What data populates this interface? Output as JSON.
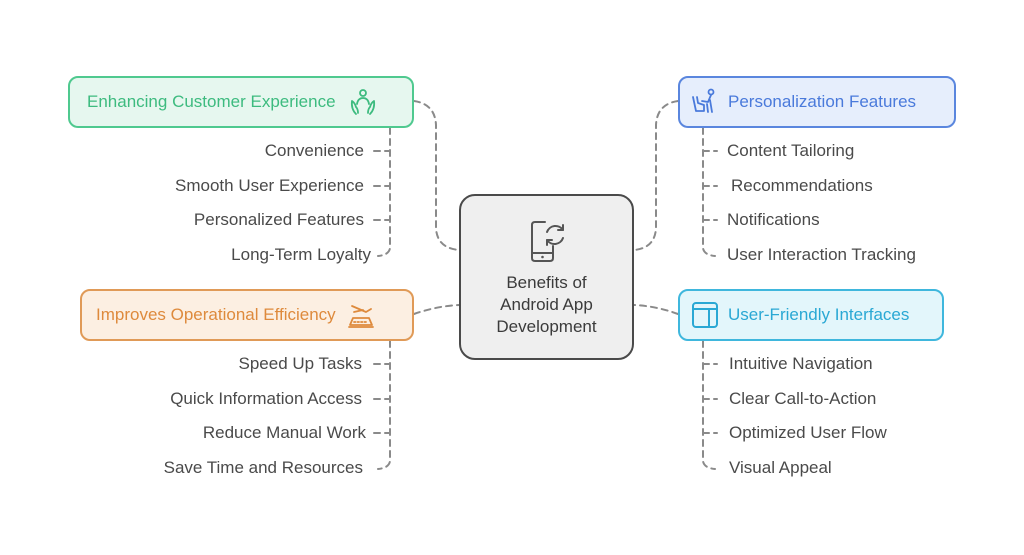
{
  "diagram": {
    "type": "mind-map",
    "central": {
      "title": "Benefits of\nAndroid App\nDevelopment",
      "icon": "phone-sync-icon"
    },
    "branches": [
      {
        "id": "customer-experience",
        "title": "Enhancing Customer Experience",
        "icon": "hands-person-icon",
        "color": "#3dbb7f",
        "position": "top-left",
        "items": [
          "Convenience",
          "Smooth User Experience",
          "Personalized Features",
          "Long-Term Loyalty"
        ]
      },
      {
        "id": "personalization",
        "title": "Personalization Features",
        "icon": "person-chair-icon",
        "color": "#4a7adb",
        "position": "top-right",
        "items": [
          "Content Tailoring",
          "Recommendations",
          "Notifications",
          "User Interaction Tracking"
        ]
      },
      {
        "id": "operational-efficiency",
        "title": "Improves Operational Efficiency",
        "icon": "airport-terminal-icon",
        "color": "#de8a3c",
        "position": "bottom-left",
        "items": [
          "Speed Up Tasks",
          "Quick Information Access",
          "Reduce Manual Work",
          "Save Time and Resources"
        ]
      },
      {
        "id": "user-friendly",
        "title": "User-Friendly Interfaces",
        "icon": "layout-window-icon",
        "color": "#2aa8d4",
        "position": "bottom-right",
        "items": [
          "Intuitive Navigation",
          "Clear Call-to-Action",
          "Optimized User Flow",
          "Visual Appeal"
        ]
      }
    ]
  }
}
